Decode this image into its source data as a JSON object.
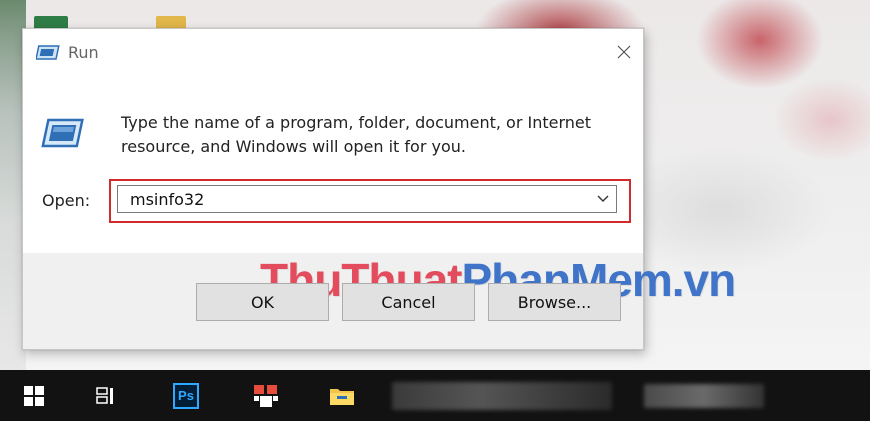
{
  "dialog": {
    "title": "Run",
    "description_line1": "Type the name of a program, folder, document, or Internet",
    "description_line2": "resource, and Windows will open it for you.",
    "open_label": "Open:",
    "open_value": "msinfo32",
    "buttons": {
      "ok": "OK",
      "cancel": "Cancel",
      "browse": "Browse..."
    },
    "highlight_color": "#d22b2b"
  },
  "watermark": {
    "part1": "ThuThuat",
    "part2": "PhanMem",
    "part3": ".vn"
  },
  "taskbar": {
    "ps_label": "Ps",
    "icons": [
      "windows-start-icon",
      "task-view-icon",
      "photoshop-icon",
      "app-icon",
      "file-explorer-icon"
    ]
  },
  "colors": {
    "accent_blue": "#2f6fb5",
    "taskbar": "#121212",
    "watermark_red": "#e34c5d",
    "watermark_blue": "#3f74c9"
  }
}
